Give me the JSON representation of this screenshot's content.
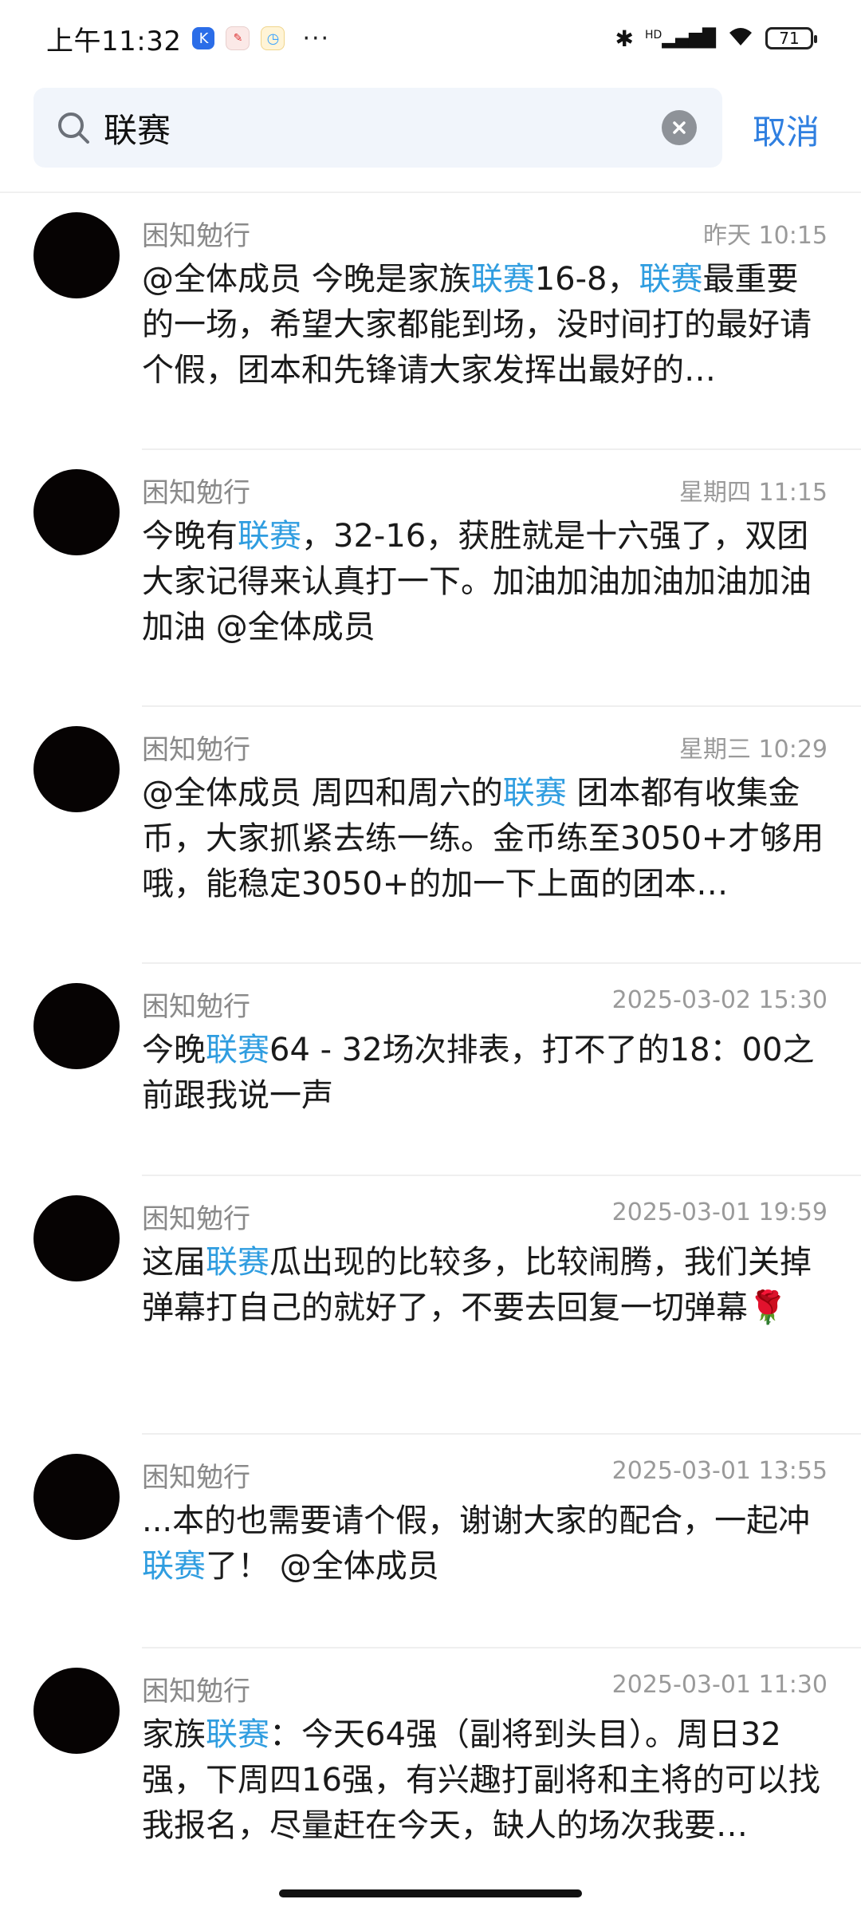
{
  "status_bar": {
    "time": "上午11:32",
    "icons": [
      "k-app-icon",
      "notes-app-icon",
      "clock-app-icon",
      "more-dots-icon"
    ],
    "more": "···",
    "battery": "71",
    "network": "HD"
  },
  "search": {
    "query": "联赛",
    "cancel_label": "取消"
  },
  "colors": {
    "accent": "#2f7fe0",
    "highlight": "#2f9de0",
    "avatar": "#060303"
  },
  "results": [
    {
      "sender": "困知勉行",
      "time": "昨天 10:15",
      "segments": [
        {
          "t": "@全体成员  今晚是家族"
        },
        {
          "t": "联赛",
          "hl": true
        },
        {
          "t": "16-8，"
        },
        {
          "t": "联赛",
          "hl": true
        },
        {
          "t": "最重要的一场，希望大家都能到场，没时间打的最好请个假，团本和先锋请大家发挥出最好的…"
        }
      ]
    },
    {
      "sender": "困知勉行",
      "time": "星期四 11:15",
      "segments": [
        {
          "t": "今晚有"
        },
        {
          "t": "联赛",
          "hl": true
        },
        {
          "t": "，32-16，获胜就是十六强了，双团大家记得来认真打一下。加油加油加油加油加油加油 @全体成员"
        }
      ]
    },
    {
      "sender": "困知勉行",
      "time": "星期三 10:29",
      "segments": [
        {
          "t": "@全体成员  周四和周六的"
        },
        {
          "t": "联赛",
          "hl": true
        },
        {
          "t": " 团本都有收集金币，大家抓紧去练一练。金币练至3050+才够用哦，能稳定3050+的加一下上面的团本…"
        }
      ]
    },
    {
      "sender": "困知勉行",
      "time": "2025-03-02 15:30",
      "segments": [
        {
          "t": "今晚"
        },
        {
          "t": "联赛",
          "hl": true
        },
        {
          "t": "64 - 32场次排表，打不了的18：00之前跟我说一声"
        }
      ]
    },
    {
      "sender": "困知勉行",
      "time": "2025-03-01 19:59",
      "segments": [
        {
          "t": "这届"
        },
        {
          "t": "联赛",
          "hl": true
        },
        {
          "t": "瓜出现的比较多，比较闹腾，我们关掉弹幕打自己的就好了，不要去回复一切弹幕🌹"
        }
      ]
    },
    {
      "sender": "困知勉行",
      "time": "2025-03-01 13:55",
      "segments": [
        {
          "t": "...本的也需要请个假，谢谢大家的配合，一起冲"
        },
        {
          "t": "联赛",
          "hl": true
        },
        {
          "t": "了！ @全体成员"
        }
      ]
    },
    {
      "sender": "困知勉行",
      "time": "2025-03-01 11:30",
      "segments": [
        {
          "t": "家族"
        },
        {
          "t": "联赛",
          "hl": true
        },
        {
          "t": "：今天64强（副将到头目）。周日32强，下周四16强，有兴趣打副将和主将的可以找我报名，尽量赶在今天，缺人的场次我要…"
        }
      ]
    }
  ]
}
